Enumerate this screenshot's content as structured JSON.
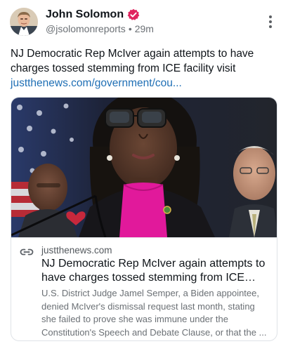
{
  "post": {
    "author_name": "John Solomon",
    "handle": "@jsolomonreports",
    "separator": "•",
    "time_ago": "29m",
    "text": "NJ Democratic Rep McIver again attempts to have charges tossed stemming from ICE facility visit",
    "link_text": "justthenews.com/government/cou..."
  },
  "card": {
    "domain": "justthenews.com",
    "title": "NJ Democratic Rep McIver again attempts to have charges tossed stemming from ICE facilit...",
    "description": "U.S. District Judge Jamel Semper, a Biden appointee, denied McIver's dismissal request last month, stating she failed to prove she was immune under the Constitution's Speech and Debate Clause, or that the ..."
  },
  "colors": {
    "link": "#1f6fb5",
    "verified_badge": "#e0245e",
    "secondary_text": "#6b7075"
  },
  "icons": {
    "verified": "verified-badge-icon",
    "more": "more-vertical-icon",
    "link": "link-icon"
  }
}
